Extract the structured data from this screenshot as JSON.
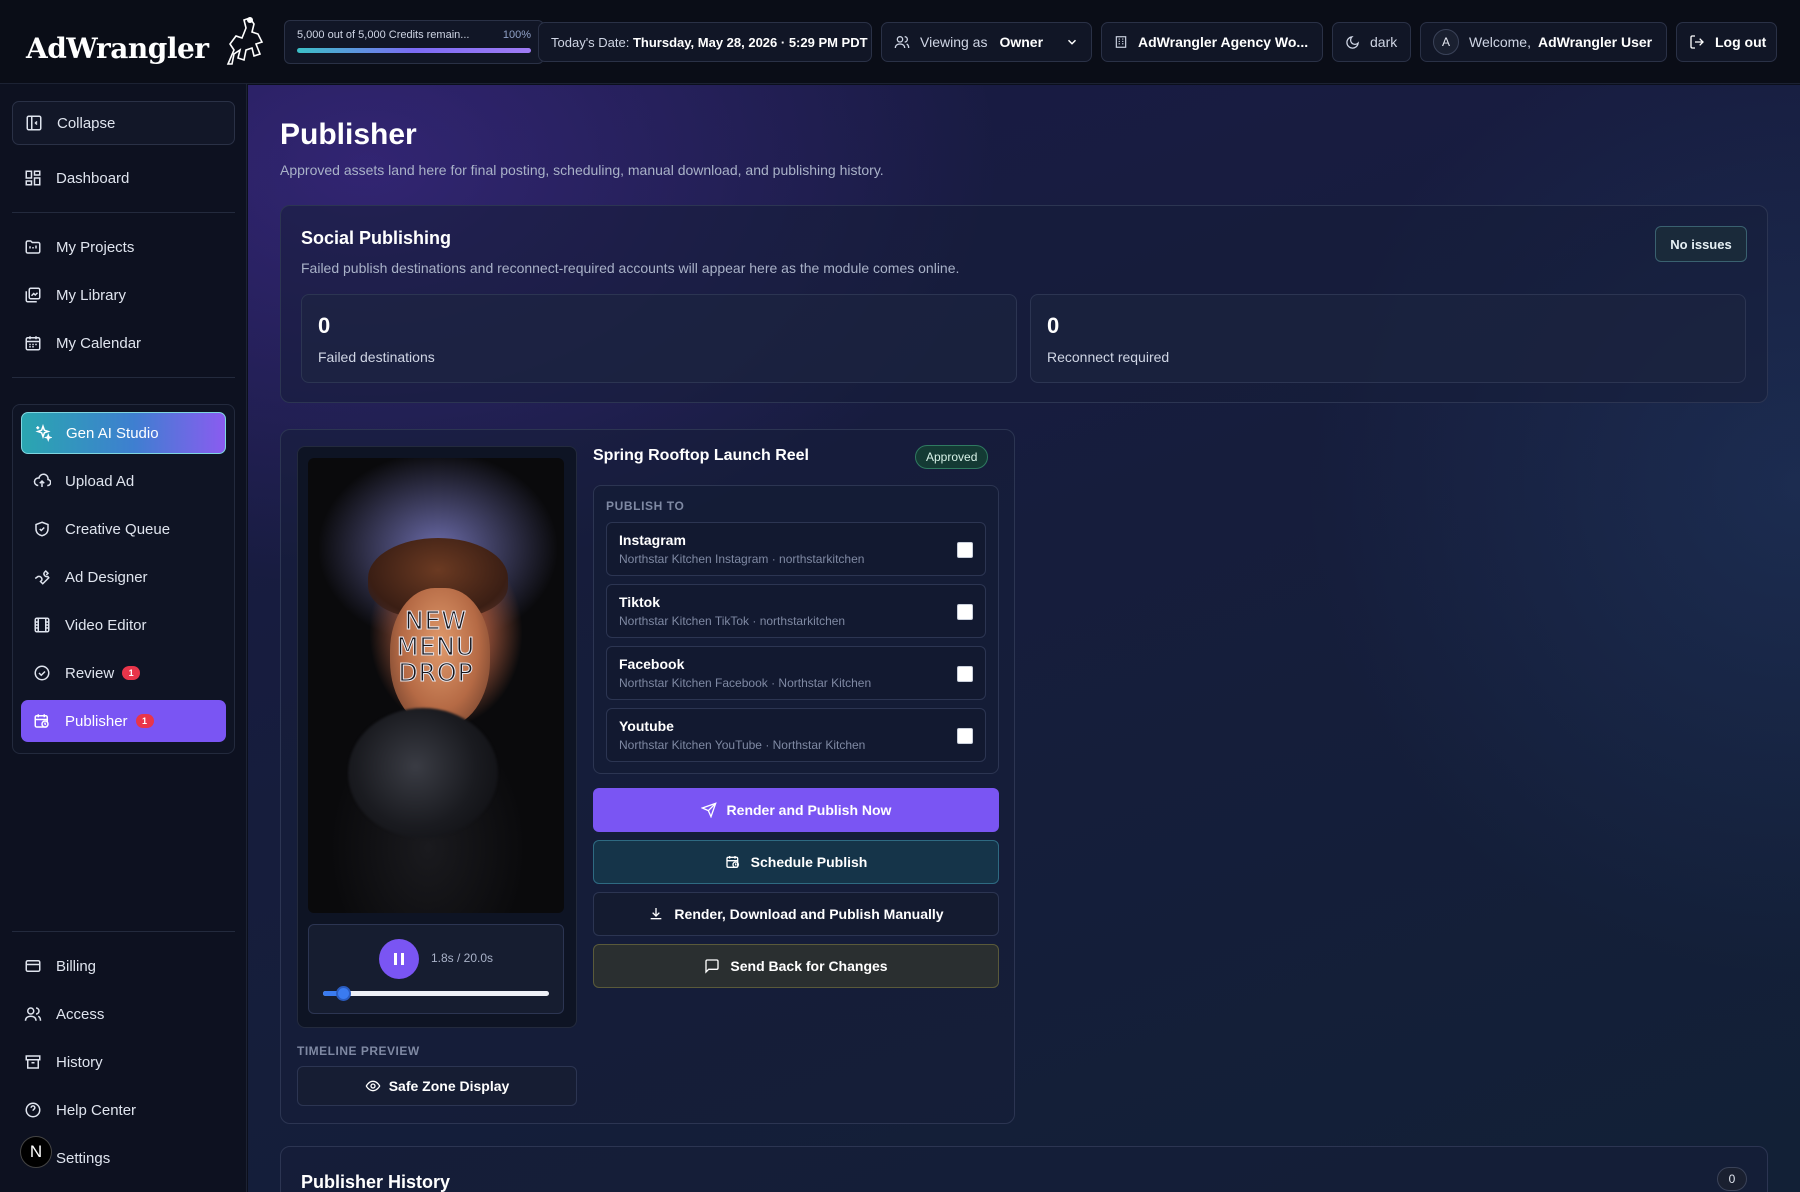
{
  "brand": {
    "name": "AdWrangler"
  },
  "topbar": {
    "credits_text": "5,000 out of 5,000 Credits remain...",
    "credits_pct": "100%",
    "credits_fraction": 1.0,
    "date_label": "Today's Date:",
    "date_value": "Thursday, May 28, 2026 · 5:29 PM PDT",
    "viewing_label": "Viewing as",
    "viewing_value": "Owner",
    "agency": "AdWrangler Agency Wo...",
    "theme": "dark",
    "avatar_initial": "A",
    "welcome_label": "Welcome,",
    "welcome_name": "AdWrangler User",
    "logout": "Log out"
  },
  "sidebar": {
    "collapse": "Collapse",
    "dashboard": "Dashboard",
    "nav": [
      {
        "label": "My Projects",
        "icon": "folder-icon"
      },
      {
        "label": "My Library",
        "icon": "library-icon"
      },
      {
        "label": "My Calendar",
        "icon": "calendar-icon"
      }
    ],
    "tools": [
      {
        "label": "Gen AI Studio",
        "icon": "sparkles-icon"
      },
      {
        "label": "Upload Ad",
        "icon": "cloud-upload-icon"
      },
      {
        "label": "Creative Queue",
        "icon": "shield-icon"
      },
      {
        "label": "Ad Designer",
        "icon": "wrench-icon"
      },
      {
        "label": "Video Editor",
        "icon": "film-icon"
      },
      {
        "label": "Review",
        "icon": "check-circle-icon",
        "badge": "1"
      },
      {
        "label": "Publisher",
        "icon": "calendar-clock-icon",
        "badge": "1"
      }
    ],
    "bottom": [
      {
        "label": "Billing",
        "icon": "credit-card-icon"
      },
      {
        "label": "Access",
        "icon": "users-icon"
      },
      {
        "label": "History",
        "icon": "archive-icon"
      },
      {
        "label": "Help Center",
        "icon": "help-circle-icon"
      },
      {
        "label": "Settings",
        "icon": "settings-icon"
      }
    ],
    "user_initial": "N"
  },
  "page": {
    "title": "Publisher",
    "subtitle": "Approved assets land here for final posting, scheduling, manual download, and publishing history."
  },
  "social": {
    "title": "Social Publishing",
    "subtitle": "Failed publish destinations and reconnect-required accounts will appear here as the module comes online.",
    "status": "No issues",
    "failed_count": "0",
    "failed_label": "Failed destinations",
    "reconnect_count": "0",
    "reconnect_label": "Reconnect required"
  },
  "asset": {
    "title": "Spring Rooftop Launch Reel",
    "status": "Approved",
    "overlay_text": [
      "NEW",
      "MENU",
      "DROP"
    ],
    "time": "1.8s / 20.0s",
    "progress_fraction": 0.09,
    "timeline_label": "TIMELINE PREVIEW",
    "safe_zone": "Safe Zone Display",
    "publish_to_label": "PUBLISH TO",
    "destinations": [
      {
        "name": "Instagram",
        "account": "Northstar Kitchen Instagram · northstarkitchen",
        "checked": false
      },
      {
        "name": "Tiktok",
        "account": "Northstar Kitchen TikTok · northstarkitchen",
        "checked": false
      },
      {
        "name": "Facebook",
        "account": "Northstar Kitchen Facebook · Northstar Kitchen",
        "checked": false
      },
      {
        "name": "Youtube",
        "account": "Northstar Kitchen YouTube · Northstar Kitchen",
        "checked": false
      }
    ],
    "actions": {
      "publish_now": "Render and Publish Now",
      "schedule": "Schedule Publish",
      "download": "Render, Download and Publish Manually",
      "send_back": "Send Back for Changes"
    }
  },
  "history": {
    "title": "Publisher History",
    "count": "0"
  },
  "colors": {
    "accent": "#7a55f3",
    "badge": "#e8354a",
    "approved": "#143a34"
  }
}
